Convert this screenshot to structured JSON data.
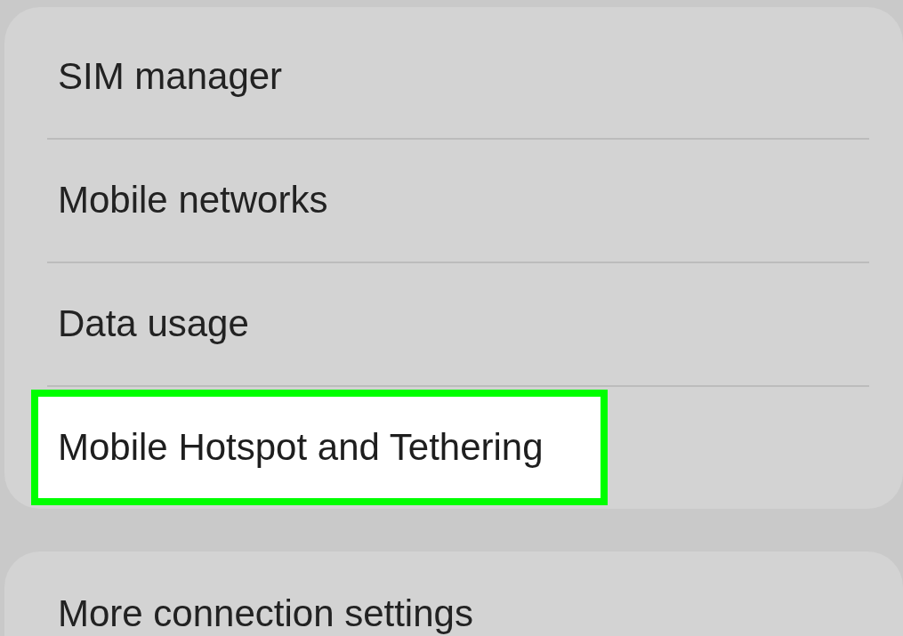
{
  "groups": [
    {
      "items": [
        {
          "label": "SIM manager",
          "selected": false
        },
        {
          "label": "Mobile networks",
          "selected": false
        },
        {
          "label": "Data usage",
          "selected": false
        },
        {
          "label": "Mobile Hotspot and Tethering",
          "selected": true
        }
      ]
    },
    {
      "items": [
        {
          "label": "More connection settings",
          "selected": false
        }
      ]
    }
  ]
}
